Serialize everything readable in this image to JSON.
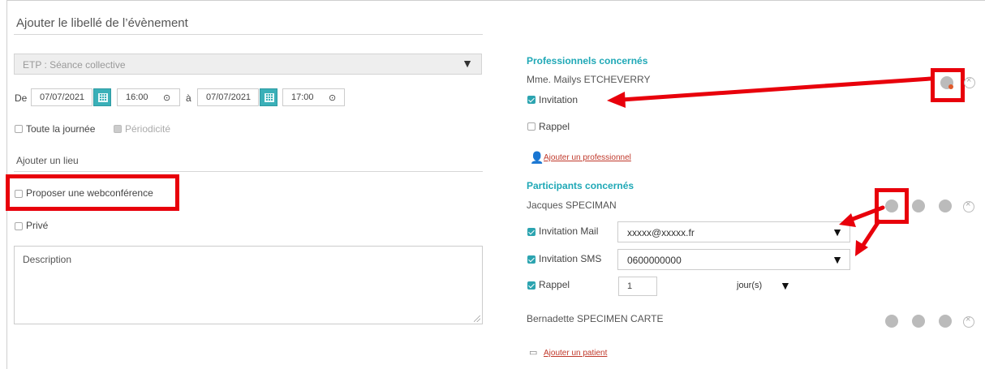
{
  "event": {
    "title_placeholder": "Ajouter le libellé de l’évènement",
    "type_value": "ETP : Séance collective",
    "from_label": "De",
    "to_label": "à",
    "start_date": "07/07/2021",
    "start_time": "16:00",
    "end_date": "07/07/2021",
    "end_time": "17:00",
    "all_day_label": "Toute la journée",
    "periodicity_label": "Périodicité",
    "location_placeholder": "Ajouter un lieu",
    "webconf_label": "Proposer une webconférence",
    "private_label": "Privé",
    "description_placeholder": "Description"
  },
  "professionals": {
    "heading": "Professionnels concernés",
    "name": "Mme. Mailys ETCHEVERRY",
    "invitation_label": "Invitation",
    "reminder_label": "Rappel",
    "add_link": "Ajouter un professionnel"
  },
  "participants": {
    "heading": "Participants concernés",
    "p1": {
      "name": "Jacques SPECIMAN",
      "invite_mail_label": "Invitation Mail",
      "mail_value": "xxxxx@xxxxx.fr",
      "invite_sms_label": "Invitation SMS",
      "sms_value": "0600000000",
      "reminder_label": "Rappel",
      "reminder_value": "1",
      "unit_value": "jour(s)"
    },
    "p2": {
      "name": "Bernadette SPECIMEN CARTE"
    },
    "add_link": "Ajouter un patient"
  },
  "colors": {
    "accent": "#1fa8b6",
    "highlight": "#e8000b",
    "link": "#c0392b"
  },
  "icons": [
    "calendar-icon",
    "clock-icon",
    "bell-icon",
    "edit-icon",
    "link-icon",
    "remove-icon",
    "add-user-icon",
    "add-patient-icon"
  ]
}
